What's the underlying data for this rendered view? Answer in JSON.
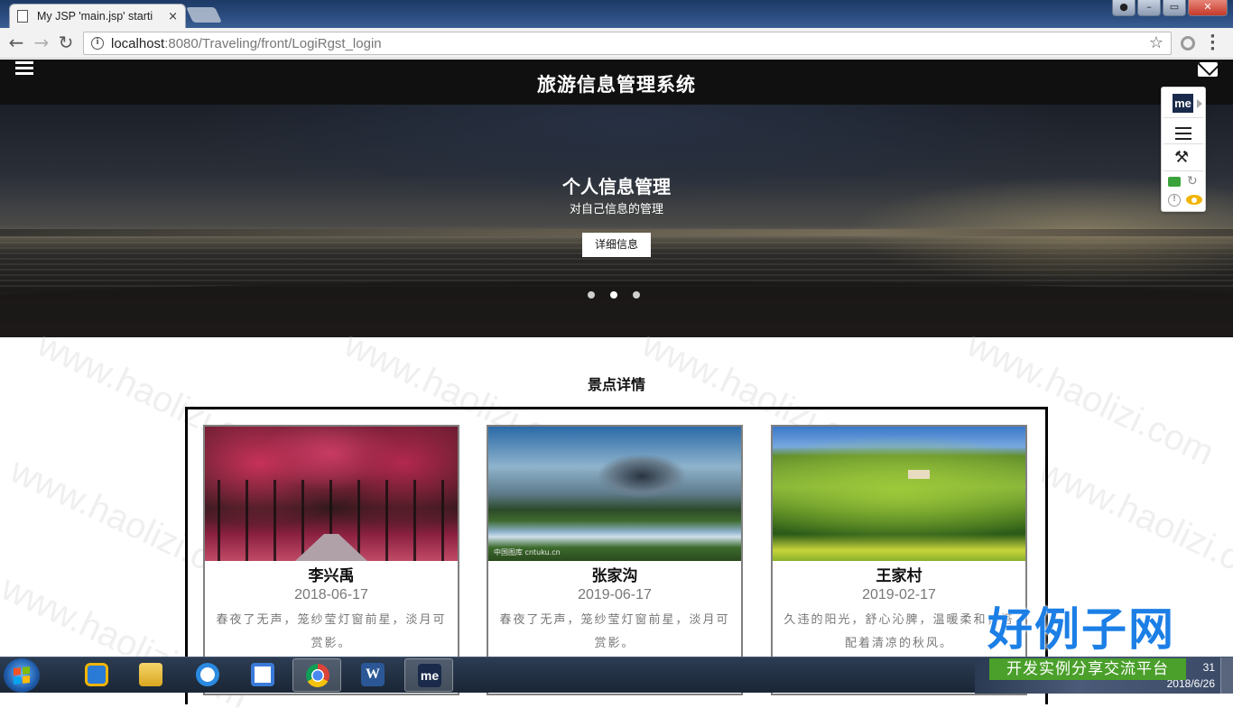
{
  "browser": {
    "tab_title": "My JSP 'main.jsp' starti",
    "tab_close": "×",
    "url_host": "localhost",
    "url_path": ":8080/Traveling/front/LogiRgst_login",
    "nav": {
      "back": "←",
      "forward": "→",
      "reload": "↻"
    },
    "star": "☆",
    "info": "i",
    "window_buttons": {
      "minimize": "–",
      "maximize": "▭",
      "close": "✕"
    }
  },
  "header": {
    "site_title": "旅游信息管理系统"
  },
  "hero": {
    "title": "个人信息管理",
    "subtitle": "对自己信息的管理",
    "button_label": "详细信息",
    "active_slide_index": 1,
    "slide_count": 3
  },
  "section": {
    "title": "景点详情"
  },
  "cards": [
    {
      "name": "李兴禹",
      "date": "2018-06-17",
      "desc": "春夜了无声，笼纱莹灯窗前星，淡月可赏影。"
    },
    {
      "name": "张家沟",
      "date": "2019-06-17",
      "desc": "春夜了无声，笼纱莹灯窗前星，淡月可赏影。",
      "image_watermark": "中国图库 cntuku.cn"
    },
    {
      "name": "王家村",
      "date": "2019-02-17",
      "desc": "久违的阳光，舒心沁脾，温暖柔和，搭配着清凉的秋风。"
    }
  ],
  "extension": {
    "logo": "me",
    "wand": "⚒",
    "refresh": "↻",
    "warn": "!"
  },
  "watermark": "www.haolizi.com",
  "taskbar": {
    "word_label": "W",
    "me_label": "me",
    "clock_time": "31",
    "clock_date": "2018/6/26"
  },
  "brand": {
    "main": "好例子网",
    "sub": "开发实例分享交流平台"
  },
  "colors": {
    "header_bg": "#101010",
    "brand_blue": "#1c7fe6",
    "brand_green": "#4aa02a"
  }
}
